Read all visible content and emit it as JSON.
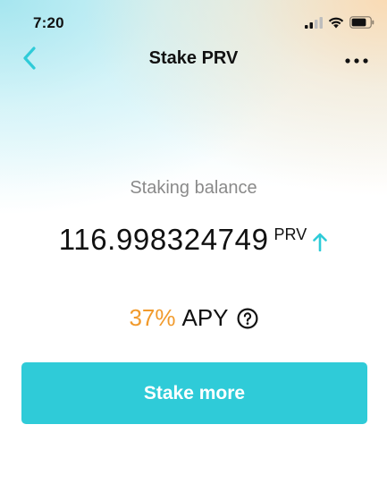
{
  "status_bar": {
    "time": "7:20",
    "signal_icon": "signal-bars-icon",
    "wifi_icon": "wifi-icon",
    "battery_icon": "battery-icon",
    "battery_level": 0.8
  },
  "nav": {
    "title": "Stake PRV",
    "back_icon": "chevron-left-icon",
    "more_icon": "more-dots-icon"
  },
  "balance": {
    "label": "Staking balance",
    "amount": "116.998324749",
    "unit": "PRV",
    "trend_icon": "arrow-up-icon"
  },
  "apy": {
    "percent": "37%",
    "label": "APY",
    "help_icon": "question-circle-icon"
  },
  "actions": {
    "stake_more_label": "Stake more"
  },
  "colors": {
    "accent": "#2fcbd8",
    "apy_orange": "#f19a2c",
    "muted_text": "#8a8a8a",
    "primary_text": "#111111"
  }
}
